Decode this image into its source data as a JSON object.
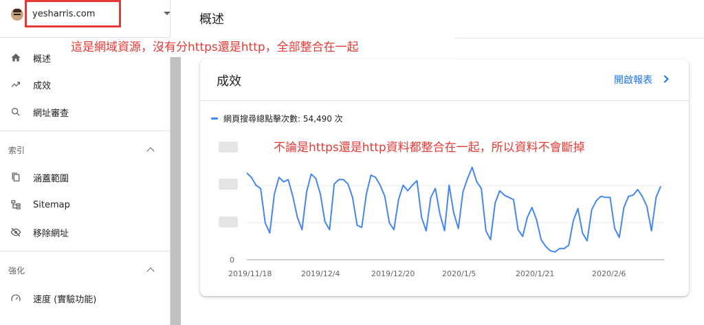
{
  "property": {
    "name": "yesharris.com"
  },
  "header": {
    "title": "概述"
  },
  "sidebar": {
    "items": [
      {
        "label": "概述",
        "icon": "home-icon",
        "active": true
      },
      {
        "label": "成效",
        "icon": "trending-up-icon",
        "active": false
      },
      {
        "label": "網址審查",
        "icon": "search-icon",
        "active": false
      }
    ],
    "section_index": {
      "label": "索引",
      "items": [
        {
          "label": "涵蓋範圍",
          "icon": "copy-pages-icon"
        },
        {
          "label": "Sitemap",
          "icon": "sitemap-icon"
        },
        {
          "label": "移除網址",
          "icon": "eye-off-icon"
        }
      ]
    },
    "section_enhance": {
      "label": "強化",
      "items": [
        {
          "label": "速度 (實驗功能)",
          "icon": "gauge-icon"
        }
      ]
    }
  },
  "annotations": {
    "top": "這是網域資源，沒有分https還是http，全部整合在一起",
    "chart": "不論是https還是http資料都整合在一起，所以資料不會斷掉"
  },
  "card": {
    "title": "成效",
    "link": "開啟報表",
    "legend": "網頁搜尋總點擊次數: 54,490 次"
  },
  "colors": {
    "accent": "#1a73e8",
    "series": "#4285f4",
    "annotation": "#e53935"
  },
  "chart_data": {
    "type": "line",
    "x_tick_labels": [
      "2019/11/18",
      "2019/12/4",
      "2019/12/20",
      "2020/1/5",
      "2020/1/21",
      "2020/2/6"
    ],
    "y_tick_labels": [
      "0"
    ],
    "grid": true,
    "series": [
      {
        "name": "網頁搜尋總點擊次數",
        "values": [
          0.78,
          0.74,
          0.67,
          0.64,
          0.33,
          0.24,
          0.59,
          0.74,
          0.7,
          0.72,
          0.57,
          0.38,
          0.27,
          0.61,
          0.77,
          0.73,
          0.59,
          0.34,
          0.27,
          0.68,
          0.72,
          0.72,
          0.68,
          0.56,
          0.31,
          0.29,
          0.59,
          0.76,
          0.74,
          0.67,
          0.57,
          0.33,
          0.27,
          0.54,
          0.67,
          0.62,
          0.67,
          0.71,
          0.38,
          0.26,
          0.56,
          0.64,
          0.41,
          0.26,
          0.67,
          0.42,
          0.28,
          0.61,
          0.73,
          0.83,
          0.7,
          0.64,
          0.26,
          0.18,
          0.51,
          0.62,
          0.58,
          0.56,
          0.54,
          0.27,
          0.21,
          0.38,
          0.47,
          0.36,
          0.18,
          0.12,
          0.08,
          0.07,
          0.1,
          0.1,
          0.13,
          0.35,
          0.46,
          0.24,
          0.17,
          0.45,
          0.53,
          0.57,
          0.56,
          0.56,
          0.28,
          0.2,
          0.47,
          0.57,
          0.58,
          0.63,
          0.57,
          0.48,
          0.26,
          0.56,
          0.66
        ]
      }
    ]
  }
}
